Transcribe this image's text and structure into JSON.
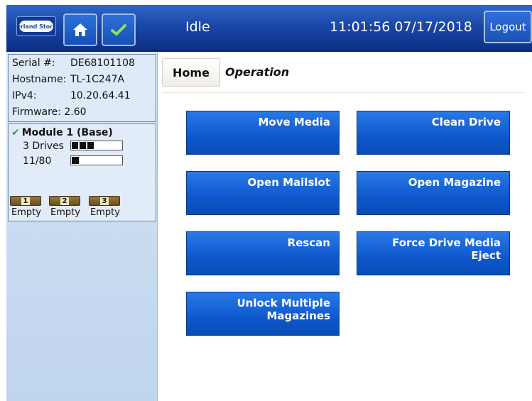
{
  "header": {
    "logo_text": "Overland Storage",
    "status": "Idle",
    "clock": "11:01:56  07/17/2018",
    "logout_label": "Logout"
  },
  "sidebar": {
    "serial_label": "Serial #:",
    "serial_value": "DE68101108",
    "hostname_label": "Hostname:",
    "hostname_value": "TL-1C247A",
    "ipv4_label": "IPv4:",
    "ipv4_value": "10.20.64.41",
    "firmware_label": "Firmware:",
    "firmware_value": "2.60",
    "module": {
      "title": "Module 1 (Base)",
      "drives_label": "3 Drives",
      "drives_count": 3,
      "slots_label": "11/80",
      "slots_fill_fraction": 0.1375
    },
    "magazines": [
      {
        "number": "1",
        "status": "Empty"
      },
      {
        "number": "2",
        "status": "Empty"
      },
      {
        "number": "3",
        "status": "Empty"
      }
    ]
  },
  "breadcrumb": {
    "home": "Home",
    "current": "Operation"
  },
  "operations": [
    "Move Media",
    "Clean Drive",
    "Open Mailslot",
    "Open Magazine",
    "Rescan",
    "Force Drive Media Eject",
    "Unlock Multiple Magazines"
  ],
  "colors": {
    "header_blue": "#1a48a8",
    "button_blue": "#0e58cc",
    "sidebar_bg": "#c9dcf1",
    "check_green": "#3a9a2e"
  },
  "icons": {
    "home": "home-icon",
    "check": "check-icon"
  }
}
